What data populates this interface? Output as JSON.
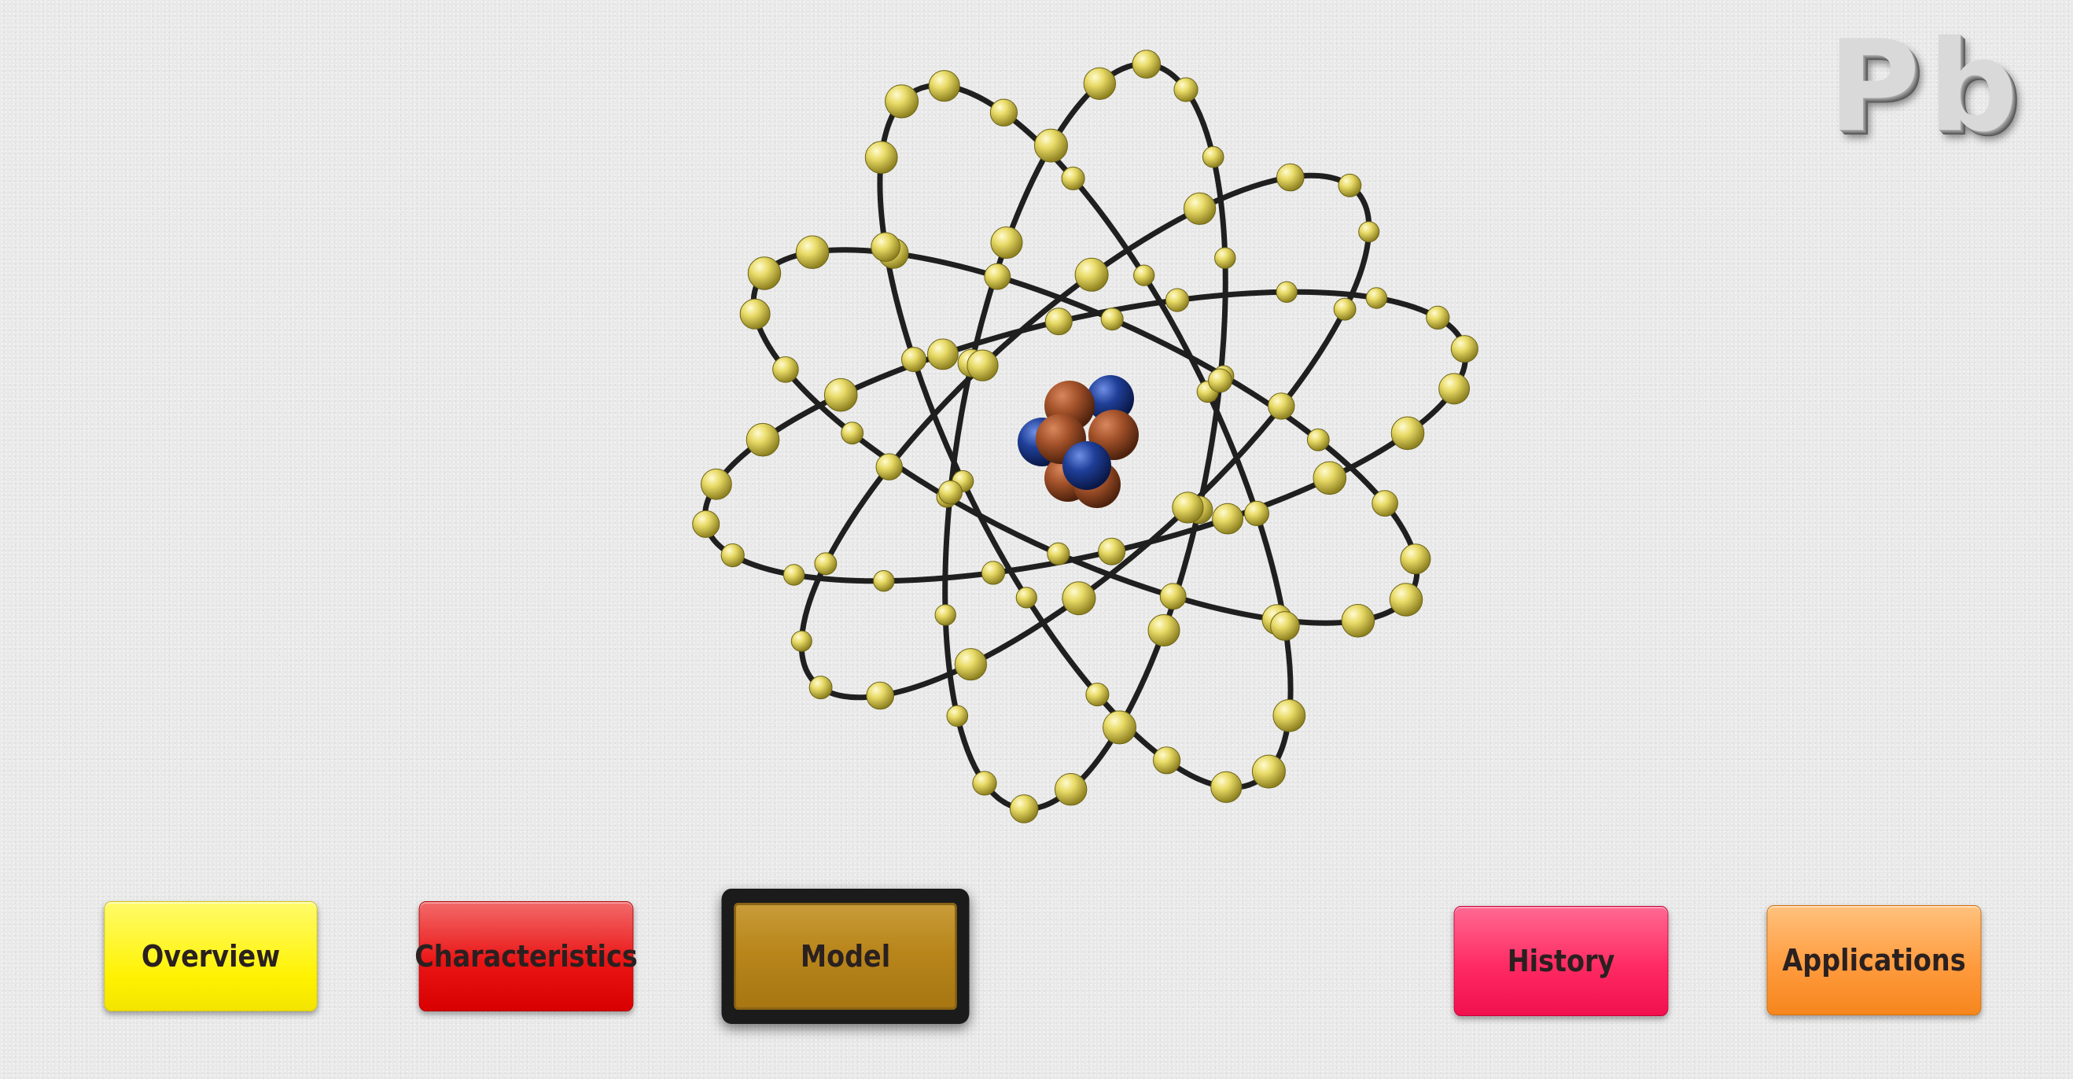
{
  "element": {
    "symbol": "Pb"
  },
  "atom_model": {
    "nucleus": {
      "proton_color": "#a4522a",
      "neutron_color": "#1f3f98"
    },
    "electron_color": "#e3d45e",
    "orbit_color": "#1f1f1f"
  },
  "nav": {
    "overview": "Overview",
    "characteristics": "Characteristics",
    "model": "Model",
    "history": "History",
    "applications": "Applications",
    "active": "Model",
    "colors": {
      "overview": "#fff200",
      "characteristics": "#e41414",
      "model": "#b8861b",
      "history": "#ff2a63",
      "applications": "#ff9b3e"
    }
  }
}
